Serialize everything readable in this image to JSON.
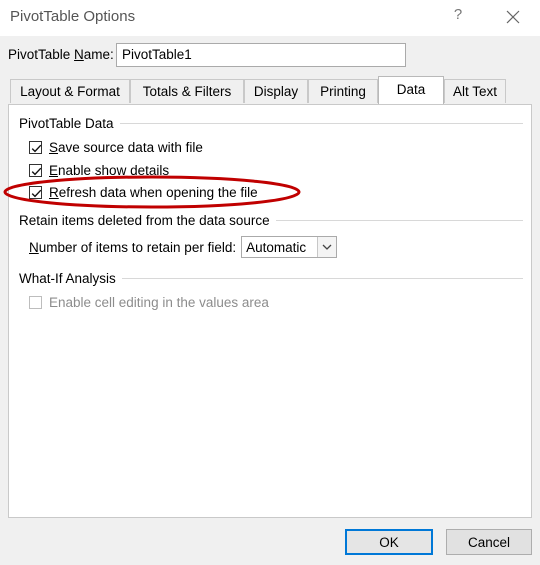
{
  "window": {
    "title": "PivotTable Options",
    "help_glyph": "?",
    "close_icon": "close-icon"
  },
  "name_field": {
    "label_before": "PivotTable ",
    "label_mnemonic": "N",
    "label_after": "ame:",
    "value": "PivotTable1"
  },
  "tabs": [
    {
      "label": "Layout & Format",
      "active": false
    },
    {
      "label": "Totals & Filters",
      "active": false
    },
    {
      "label": "Display",
      "active": false
    },
    {
      "label": "Printing",
      "active": false
    },
    {
      "label": "Data",
      "active": true
    },
    {
      "label": "Alt Text",
      "active": false
    }
  ],
  "pivot_data": {
    "heading": "PivotTable Data",
    "items": [
      {
        "mnemonic": "S",
        "rest": "ave source data with file",
        "checked": true
      },
      {
        "mnemonic": "E",
        "rest": "nable show details",
        "checked": true
      },
      {
        "mnemonic": "R",
        "rest": "efresh data when opening the file",
        "checked": true
      }
    ]
  },
  "retain": {
    "heading": "Retain items deleted from the data source",
    "label_mnemonic": "N",
    "label_rest": "umber of items to retain per field:",
    "select_value": "Automatic"
  },
  "whatif": {
    "heading": "What-If Analysis",
    "item_label": "Enable cell editing in the values area",
    "checked": false,
    "disabled": true
  },
  "buttons": {
    "ok": "OK",
    "cancel": "Cancel"
  },
  "colors": {
    "annotation": "#c00000",
    "focus_border": "#0078d7"
  }
}
